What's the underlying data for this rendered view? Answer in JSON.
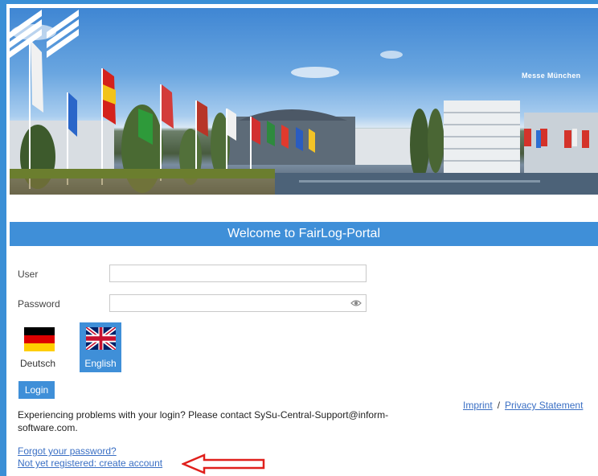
{
  "banner": {
    "brand": "Messe München",
    "logo_icon": "messe-logo-icon"
  },
  "login": {
    "title": "Welcome to FairLog-Portal",
    "user_label": "User",
    "user_value": "",
    "password_label": "Password",
    "password_value": "",
    "languages": [
      {
        "label": "Deutsch",
        "icon": "flag-germany-icon",
        "selected": false
      },
      {
        "label": "English",
        "icon": "flag-uk-icon",
        "selected": true
      }
    ],
    "login_button": "Login",
    "help_text": "Experiencing problems with your login? Please contact SySu-Central-Support@inform-software.com.",
    "forgot_link": "Forgot your password?",
    "register_link": "Not yet registered: create account",
    "imprint_link": "Imprint",
    "separator": "/",
    "privacy_link": "Privacy Statement"
  },
  "colors": {
    "accent": "#3f8fd8",
    "link": "#3a6fc4",
    "annotation_arrow": "#e0201c"
  }
}
